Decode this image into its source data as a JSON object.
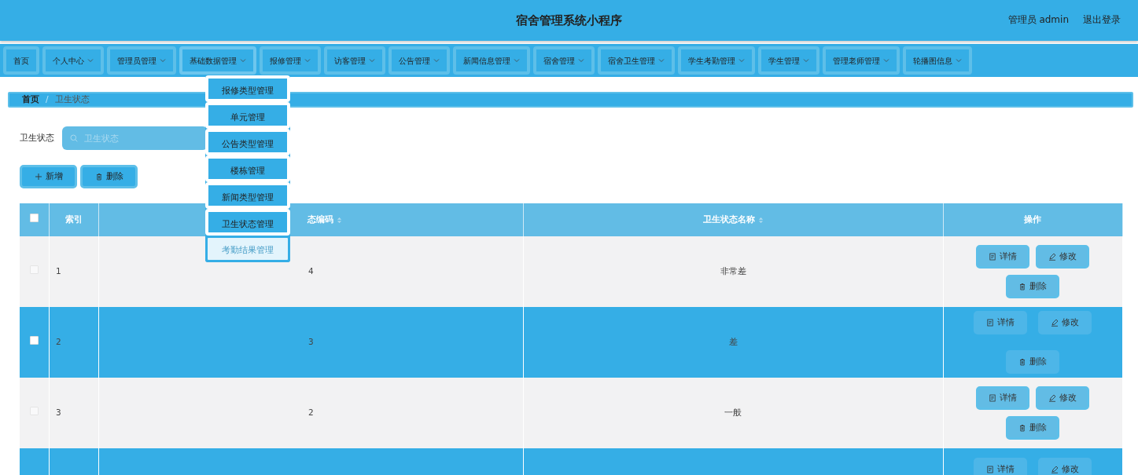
{
  "header": {
    "title": "宿舍管理系统小程序",
    "user": "管理员 admin",
    "logout": "退出登录"
  },
  "nav": [
    {
      "label": "首页",
      "dropdown": false,
      "selected": false
    },
    {
      "label": "个人中心",
      "dropdown": true,
      "selected": false
    },
    {
      "label": "管理员管理",
      "dropdown": true,
      "selected": false
    },
    {
      "label": "基础数据管理",
      "dropdown": true,
      "selected": true
    },
    {
      "label": "报修管理",
      "dropdown": true,
      "selected": false
    },
    {
      "label": "访客管理",
      "dropdown": true,
      "selected": false
    },
    {
      "label": "公告管理",
      "dropdown": true,
      "selected": false
    },
    {
      "label": "新闻信息管理",
      "dropdown": true,
      "selected": false
    },
    {
      "label": "宿舍管理",
      "dropdown": true,
      "selected": false
    },
    {
      "label": "宿舍卫生管理",
      "dropdown": true,
      "selected": false
    },
    {
      "label": "学生考勤管理",
      "dropdown": true,
      "selected": false
    },
    {
      "label": "学生管理",
      "dropdown": true,
      "selected": false
    },
    {
      "label": "管理老师管理",
      "dropdown": true,
      "selected": false
    },
    {
      "label": "轮播图信息",
      "dropdown": true,
      "selected": false
    }
  ],
  "dropdown": [
    {
      "label": "报修类型管理",
      "hovered": false
    },
    {
      "label": "单元管理",
      "hovered": false
    },
    {
      "label": "公告类型管理",
      "hovered": false
    },
    {
      "label": "楼栋管理",
      "hovered": false
    },
    {
      "label": "新闻类型管理",
      "hovered": false
    },
    {
      "label": "卫生状态管理",
      "hovered": false
    },
    {
      "label": "考勤结果管理",
      "hovered": true
    }
  ],
  "breadcrumb": [
    "首页",
    "/",
    "卫生状态"
  ],
  "search": {
    "label": "卫生状态",
    "placeholder": "卫生状态"
  },
  "actions": [
    {
      "kind": "add",
      "label": "新增"
    },
    {
      "kind": "delete",
      "label": "删除"
    }
  ],
  "table": {
    "select_all": {
      "checked": false
    },
    "columns": [
      "索引",
      "态编码",
      "卫生状态名称",
      "操作"
    ],
    "rows": [
      {
        "index": "1",
        "code": "4",
        "name": "非常差",
        "highlight": false,
        "buttons": [
          "详情",
          "修改",
          "删除"
        ]
      },
      {
        "index": "2",
        "code": "3",
        "name": "差",
        "highlight": true,
        "buttons": [
          "详情",
          "修改",
          "删除"
        ]
      },
      {
        "index": "3",
        "code": "2",
        "name": "一般",
        "highlight": false,
        "buttons": [
          "详情",
          "修改",
          "删除"
        ]
      },
      {
        "highlight": true,
        "buttons": [
          "详情",
          "修改"
        ]
      }
    ]
  }
}
